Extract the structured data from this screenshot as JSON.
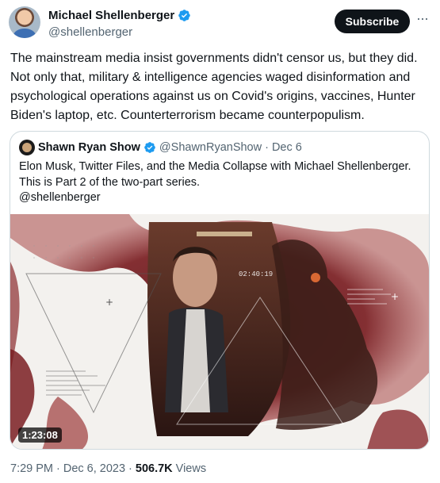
{
  "tweet": {
    "display_name": "Michael Shellenberger",
    "handle": "@shellenberger",
    "subscribe_label": "Subscribe",
    "more_label": "···",
    "text": "The mainstream media insist governments didn't censor us, but they did. Not only that, military & intelligence agencies waged disinformation and psychological operations against us on Covid's origins, vaccines, Hunter Biden's laptop, etc. Counterterrorism became counterpopulism."
  },
  "quote": {
    "display_name": "Shawn Ryan Show",
    "handle": "@ShawnRyanShow",
    "separator": "·",
    "date": "Dec 6",
    "text": "Elon Musk, Twitter Files, and the Media Collapse with Michael Shellenberger. This is Part 2 of the two-part series.\n@shellenberger",
    "video": {
      "duration": "1:23:08",
      "overlay_time": "02:40:19"
    }
  },
  "meta": {
    "time": "7:29 PM",
    "separator": "·",
    "date": "Dec 6, 2023",
    "separator2": "·",
    "views_count": "506.7K",
    "views_label": "Views"
  },
  "colors": {
    "verified_blue": "#1d9bf0",
    "text_primary": "#0f1419",
    "text_secondary": "#536471",
    "border": "#cfd9de",
    "ink_red": "#7a1e22"
  }
}
